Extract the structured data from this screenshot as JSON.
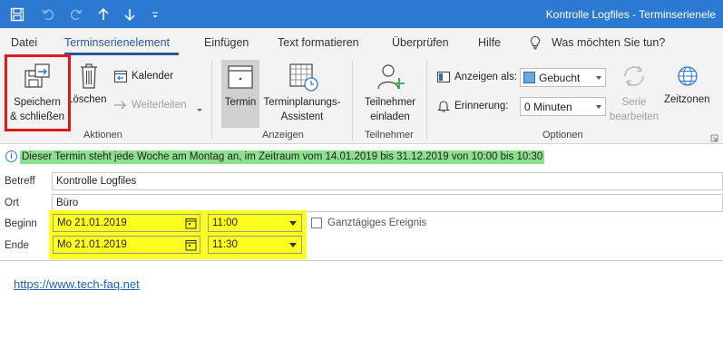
{
  "window": {
    "title": "Kontrolle Logfiles  -  Terminserienele"
  },
  "quick_access": {
    "icons": [
      "save-icon",
      "undo-icon",
      "redo-icon",
      "arrow-up-icon",
      "arrow-down-icon",
      "customize-icon"
    ]
  },
  "tabs": [
    {
      "label": "Datei"
    },
    {
      "label": "Terminserienelement",
      "active": true
    },
    {
      "label": "Einfügen"
    },
    {
      "label": "Text formatieren"
    },
    {
      "label": "Überprüfen"
    },
    {
      "label": "Hilfe"
    }
  ],
  "tell_me": {
    "text": "Was möchten Sie tun?"
  },
  "ribbon": {
    "aktionen": {
      "group_label": "Aktionen",
      "save_close_line1": "Speichern",
      "save_close_line2": "& schließen",
      "delete_label": "Löschen",
      "calendar_label": "Kalender",
      "forward_label": "Weiterleiten"
    },
    "anzeigen": {
      "group_label": "Anzeigen",
      "termin_label": "Termin",
      "assistant_line1": "Terminplanungs-",
      "assistant_line2": "Assistent"
    },
    "teilnehmer": {
      "group_label": "Teilnehmer",
      "invite_line1": "Teilnehmer",
      "invite_line2": "einladen"
    },
    "optionen": {
      "group_label": "Optionen",
      "show_as_label": "Anzeigen als:",
      "show_as_value": "Gebucht",
      "reminder_label": "Erinnerung:",
      "reminder_value": "0 Minuten",
      "series_line1": "Serie",
      "series_line2": "bearbeiten",
      "timezones_label": "Zeitzonen"
    }
  },
  "info_bar": {
    "text": "Dieser Termin steht jede Woche am Montag an, im Zeitraum vom 14.01.2019 bis 31.12.2019 von 10:00 bis 10:30"
  },
  "form": {
    "subject_label": "Betreff",
    "subject_value": "Kontrolle Logfiles",
    "location_label": "Ort",
    "location_value": "Büro",
    "start_label": "Beginn",
    "start_date": "Mo 21.01.2019",
    "start_time": "11:00",
    "end_label": "Ende",
    "end_date": "Mo 21.01.2019",
    "end_time": "11:30",
    "all_day_label": "Ganztägiges Ereignis"
  },
  "body": {
    "link": "https://www.tech-faq.net"
  },
  "colors": {
    "titlebar": "#2b79d1",
    "accent": "#2b579a",
    "highlight_red": "#e01818",
    "highlight_yellow": "#ffff1e",
    "highlight_green": "#8de08d"
  }
}
